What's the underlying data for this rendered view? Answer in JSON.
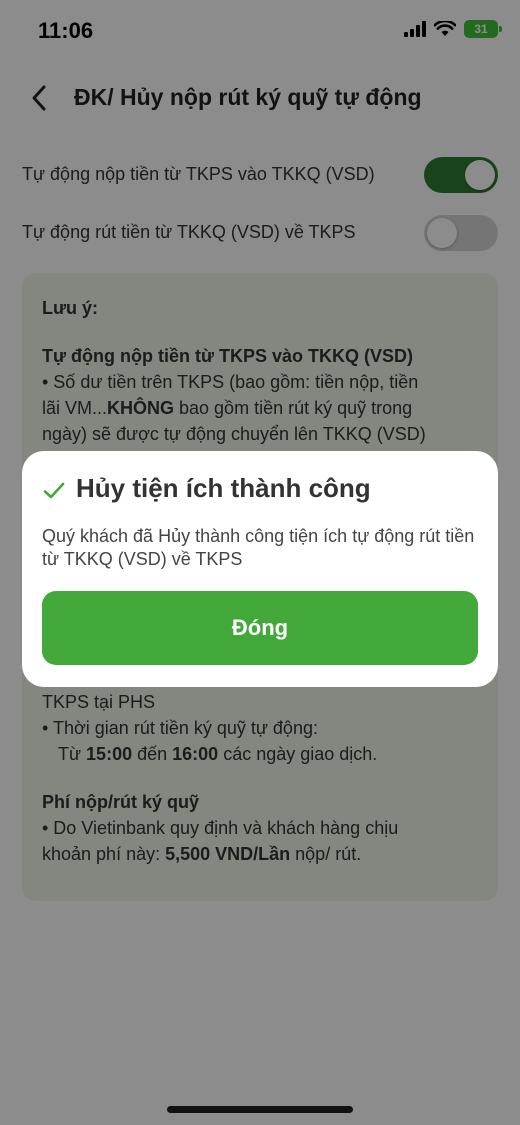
{
  "status_bar": {
    "time": "11:06",
    "battery": "31",
    "icons": [
      "signal-icon",
      "wifi-icon",
      "battery-charging-icon"
    ]
  },
  "header": {
    "title": "ĐK/ Hủy nộp rút ký quỹ tự động",
    "back_icon": "chevron-left-icon"
  },
  "toggles": [
    {
      "label": "Tự động nộp tiền từ TKPS vào TKKQ (VSD)",
      "on": true
    },
    {
      "label": "Tự động rút tiền từ TKKQ (VSD) về TKPS",
      "on": false
    }
  ],
  "note": {
    "title": "Lưu ý:",
    "deposit_heading": "Tự động nộp tiền từ TKPS vào TKKQ (VSD)",
    "deposit_line1": "• Số dư tiền trên TKPS (bao gồm: tiền nộp, tiền",
    "deposit_line2_pre": "lãi VM...",
    "deposit_line2_bold": "KHÔNG",
    "deposit_line2_post": " bao gồm tiền rút ký quỹ trong",
    "deposit_line3": "ngày) sẽ được tự động chuyển lên TKKQ (VSD)",
    "withdraw_tail": "TKPS tại PHS",
    "withdraw_time_line1": "• Thời gian rút tiền ký quỹ tự động:",
    "withdraw_time_pre": "Từ ",
    "withdraw_time_start": "15:00",
    "withdraw_time_mid": " đến ",
    "withdraw_time_end": "16:00",
    "withdraw_time_post": " các ngày giao dịch.",
    "fee_heading": "Phí nộp/rút ký quỹ",
    "fee_line1": "• Do Vietinbank quy định và khách hàng chịu",
    "fee_line2_pre": "khoản phí này: ",
    "fee_line2_bold": "5,500 VND/Lần",
    "fee_line2_post": " nộp/ rút."
  },
  "dialog": {
    "title": "Hủy tiện ích thành công",
    "message": "Quý khách đã Hủy thành công tiện ích tự động rút tiền từ TKKQ (VSD) về TKPS",
    "button_label": "Đóng",
    "icon": "check-icon"
  },
  "colors": {
    "primary_green": "#42a83a",
    "switch_on": "#2e7d32",
    "panel_bg": "#eef6ea"
  }
}
